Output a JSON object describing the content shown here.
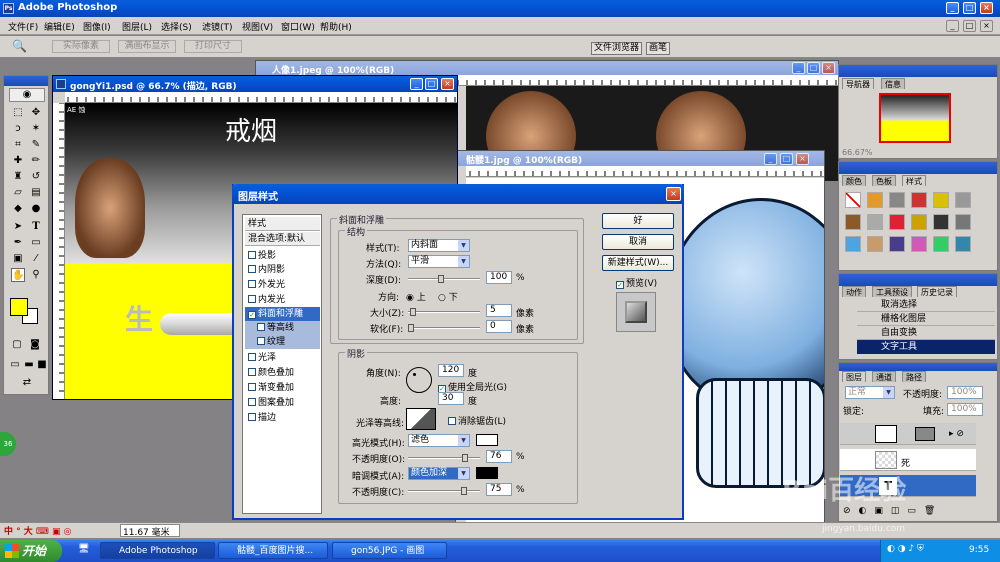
{
  "app": {
    "title": "Adobe Photoshop"
  },
  "menu": [
    "文件(F)",
    "编辑(E)",
    "图像(I)",
    "图层(L)",
    "选择(S)",
    "滤镜(T)",
    "视图(V)",
    "窗口(W)",
    "帮助(H)"
  ],
  "options_bar": {
    "btn1": "实际像素",
    "btn2": "满画布显示",
    "btn3": "打印尺寸",
    "palette_tabs": [
      "文件浏览器",
      "画笔"
    ]
  },
  "doc1": {
    "title": "gongYi1.psd @ 66.7% (描边, RGB)",
    "heading": "戒烟",
    "tab_label": "AE 蚀",
    "cig_text": "生"
  },
  "doc2": {
    "title": "人像1.jpeg @ 100%(RGB)"
  },
  "doc3": {
    "title": "骷髅1.jpg @ 100%(RGB)"
  },
  "dialog": {
    "title": "图层样式",
    "styles": [
      "样式",
      "混合选项:默认",
      "投影",
      "内阴影",
      "外发光",
      "内发光",
      "斜面和浮雕",
      "等高线",
      "纹理",
      "光泽",
      "颜色叠加",
      "渐变叠加",
      "图案叠加",
      "描边"
    ],
    "bevel": {
      "section": "斜面和浮雕",
      "structure": "结构",
      "style_label": "样式(T):",
      "style_value": "内斜面",
      "method_label": "方法(Q):",
      "method_value": "平滑",
      "depth_label": "深度(D):",
      "depth_value": "100",
      "percent": "%",
      "direction_label": "方向:",
      "dir_up": "上",
      "dir_down": "下",
      "size_label": "大小(Z):",
      "size_value": "5",
      "pixels": "像素",
      "soften_label": "软化(F):",
      "soften_value": "0"
    },
    "shading": {
      "section": "阴影",
      "angle_label": "角度(N):",
      "angle_value": "120",
      "deg": "度",
      "global_light": "使用全局光(G)",
      "altitude_label": "高度:",
      "altitude_value": "30",
      "gloss_label": "光泽等高线:",
      "anti_alias": "消除锯齿(L)",
      "highlight_label": "高光模式(H):",
      "highlight_value": "滤色",
      "hl_opacity_label": "不透明度(O):",
      "hl_opacity_value": "76",
      "shadow_label": "暗调模式(A):",
      "shadow_value": "颜色加深",
      "sh_opacity_label": "不透明度(C):",
      "sh_opacity_value": "75"
    },
    "buttons": {
      "ok": "好",
      "cancel": "取消",
      "new_style": "新建样式(W)...",
      "preview": "预览(V)"
    }
  },
  "navigator": {
    "tabs": [
      "导航器",
      "信息"
    ],
    "zoom": "66.67%"
  },
  "swatches": {
    "tabs": [
      "颜色",
      "色板",
      "样式"
    ]
  },
  "history": {
    "tabs": [
      "动作",
      "工具预设",
      "历史记录"
    ],
    "items": [
      "取消选择",
      "栅格化图层",
      "自由变换",
      "文字工具"
    ]
  },
  "layers": {
    "tabs": [
      "图层",
      "通道",
      "路径"
    ],
    "blend": "正常",
    "opacity_label": "不透明度:",
    "opacity": "100%",
    "lock_label": "锁定:",
    "fill_label": "填充:",
    "fill": "100%",
    "layer_names": [
      "死",
      "T"
    ]
  },
  "statusbar": {
    "zoom": "11.67 毫米",
    "ime": "中"
  },
  "taskbar": {
    "start": "开始",
    "items": [
      "Adobe Photoshop",
      "骷髅_百度图片搜...",
      "gon56.JPG - 画图"
    ],
    "time": "9:55"
  },
  "watermark": {
    "text": "Bai百经验",
    "url": "jingyan.baidu.com"
  },
  "colors": {
    "titlebar": "#0a5fd8",
    "dialog_bg": "#d6d3ce",
    "yellow": "#ffff00"
  }
}
